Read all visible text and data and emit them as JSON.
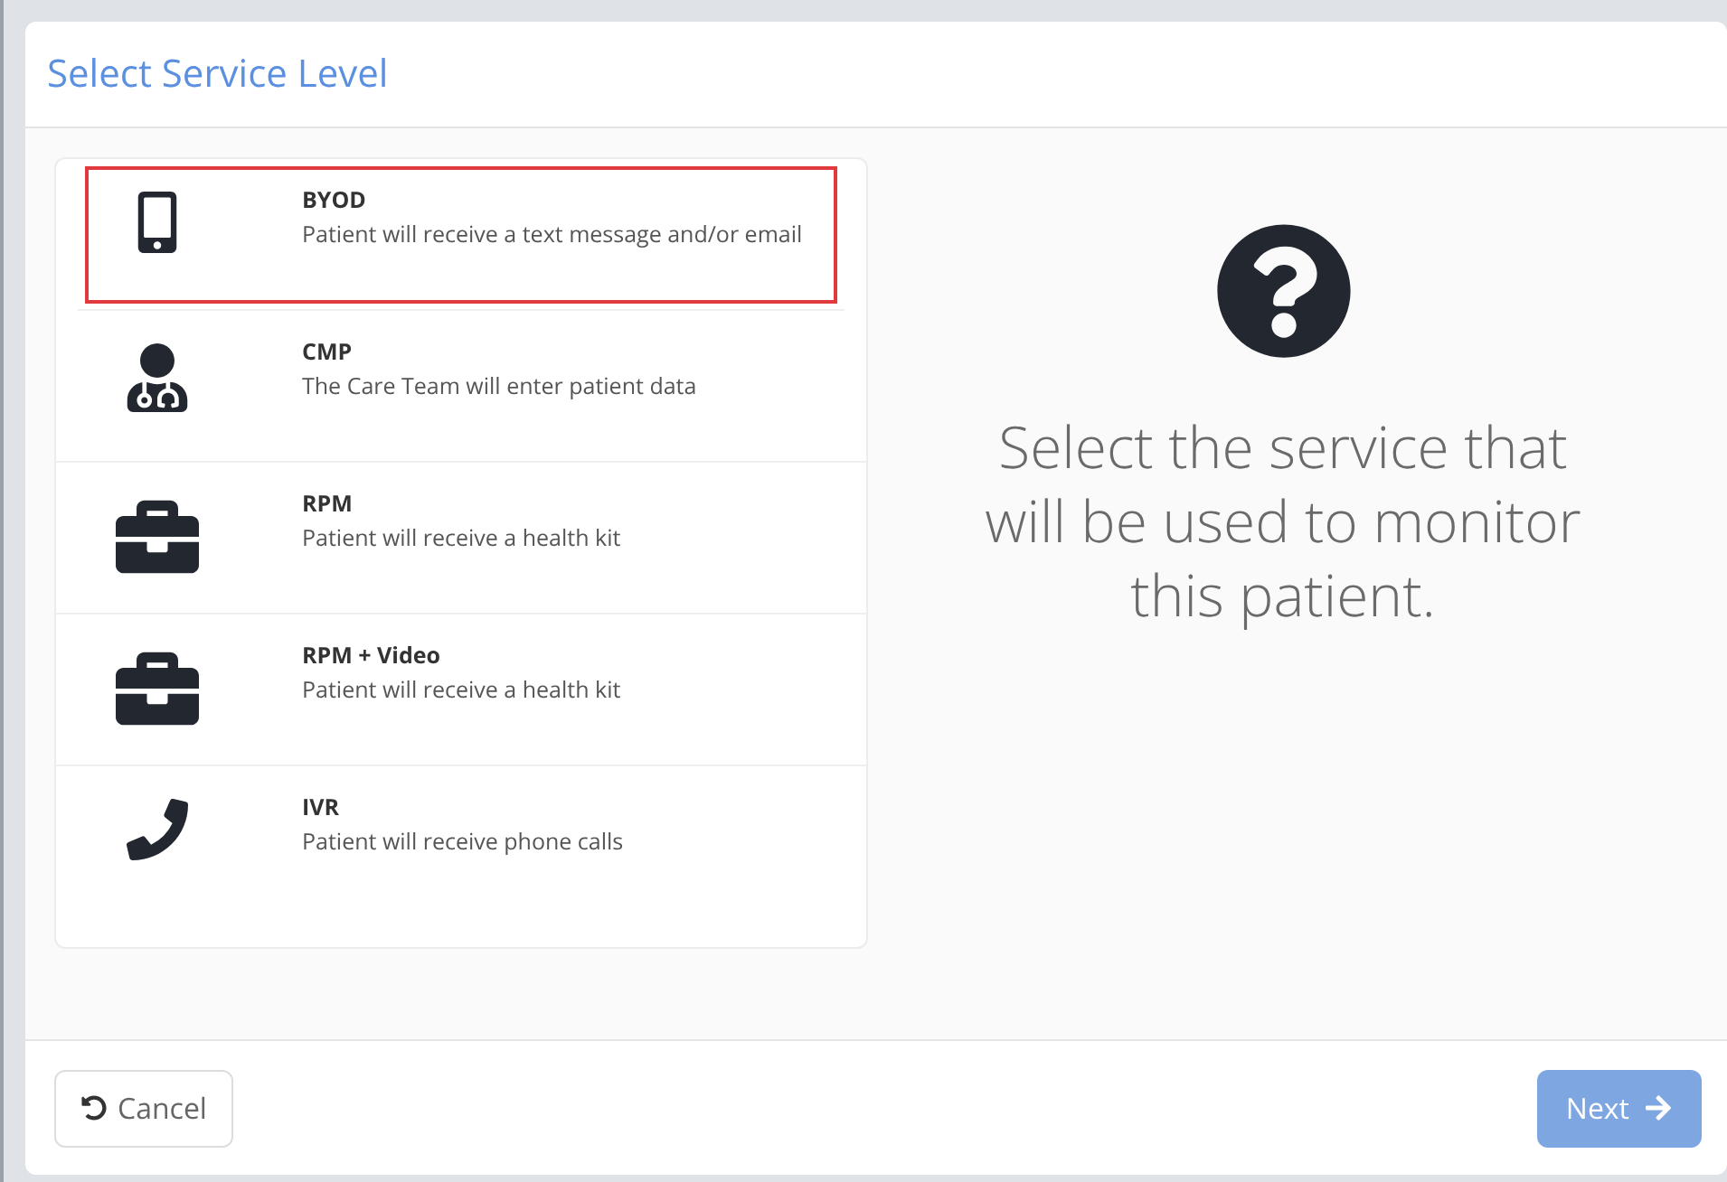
{
  "dialog": {
    "title": "Select Service Level"
  },
  "services": [
    {
      "kind": "mobile",
      "name": "BYOD",
      "description": "Patient will receive a text message and/or email",
      "selected": true
    },
    {
      "kind": "clinician",
      "name": "CMP",
      "description": "The Care Team will enter patient data",
      "selected": false
    },
    {
      "kind": "kit",
      "name": "RPM",
      "description": "Patient will receive a health kit",
      "selected": false
    },
    {
      "kind": "kit",
      "name": "RPM + Video",
      "description": "Patient will receive a health kit",
      "selected": false
    },
    {
      "kind": "phone",
      "name": "IVR",
      "description": "Patient will receive phone calls",
      "selected": false
    }
  ],
  "prompt": "Select the service that will be used to monitor this patient.",
  "buttons": {
    "cancel": {
      "label": "Cancel"
    },
    "next": {
      "label": "Next",
      "disabled": true
    }
  }
}
